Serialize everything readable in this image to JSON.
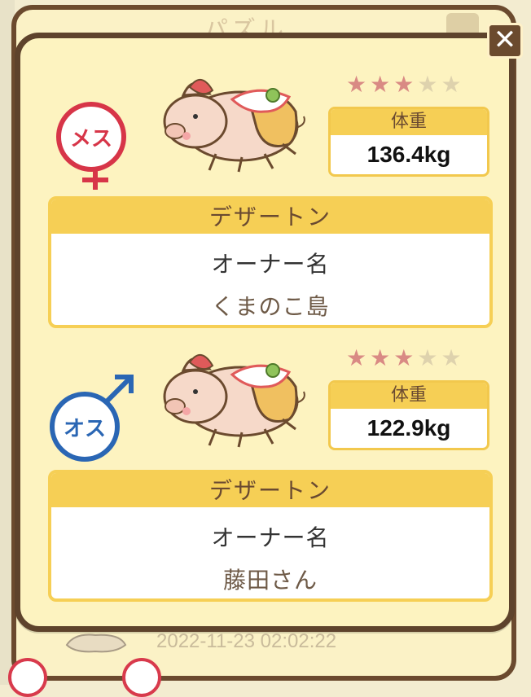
{
  "background": {
    "title_text": "パズル",
    "timestamp": "2022-11-23 02:02:22"
  },
  "modal": {
    "close_symbol": "✕",
    "pigs": [
      {
        "gender_label": "メス",
        "gender": "female",
        "stars_filled": 3,
        "stars_total": 5,
        "weight_label": "体重",
        "weight_value": "136.4kg",
        "breed_name": "デザートン",
        "owner_label": "オーナー名",
        "owner_name": "くまのこ島"
      },
      {
        "gender_label": "オス",
        "gender": "male",
        "stars_filled": 3,
        "stars_total": 5,
        "weight_label": "体重",
        "weight_value": "122.9kg",
        "breed_name": "デザートン",
        "owner_label": "オーナー名",
        "owner_name": "藤田さん"
      }
    ]
  },
  "colors": {
    "modal_bg": "#fdf3c0",
    "modal_border": "#5e432c",
    "accent_yellow": "#f6cf55",
    "female": "#d73548",
    "male": "#2a66b4",
    "star_on": "#d98a84",
    "star_off": "#ded2ad"
  }
}
